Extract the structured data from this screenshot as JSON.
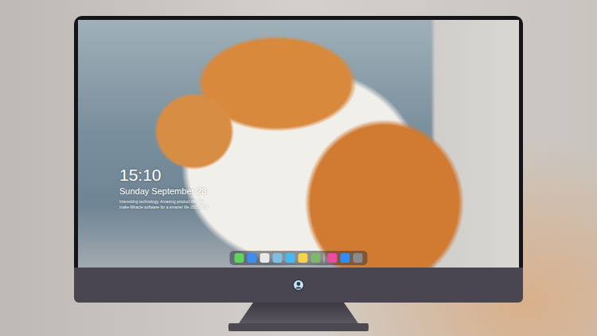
{
  "lock_screen": {
    "clock": "15:10",
    "date": "Sunday September 28",
    "note_lines": [
      "Interesting technology. Amazing product life. We",
      "make Miracle software for a smarter life 2025/9/28"
    ]
  },
  "dock": {
    "apps": [
      {
        "color": "#5fd35a"
      },
      {
        "color": "#3a8ef0"
      },
      {
        "color": "#e8e8e8"
      },
      {
        "color": "#7cc0e8"
      },
      {
        "color": "#48b8f0"
      },
      {
        "color": "#f5d24a"
      },
      {
        "color": "#7fb86a"
      },
      {
        "color": "#f04aa0"
      },
      {
        "color": "#2f8df5"
      },
      {
        "color": "#8a8a8e"
      }
    ]
  }
}
